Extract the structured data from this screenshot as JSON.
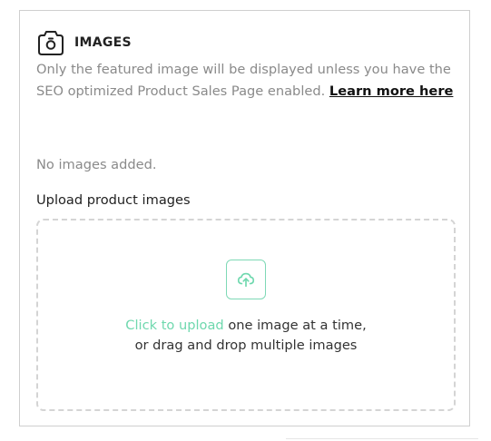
{
  "section": {
    "title": "IMAGES",
    "icon": "camera-icon",
    "description": "Only the featured image will be displayed unless you have the SEO optimized Product Sales Page enabled. ",
    "learn_more": "Learn more here",
    "empty_state": "No images added.",
    "upload_label": "Upload product images"
  },
  "dropzone": {
    "icon": "cloud-upload-icon",
    "click_to_upload": "Click to upload",
    "line1_rest": " one image at a time,",
    "line2": "or drag and drop multiple images",
    "accent_color": "#6fd8ae"
  }
}
